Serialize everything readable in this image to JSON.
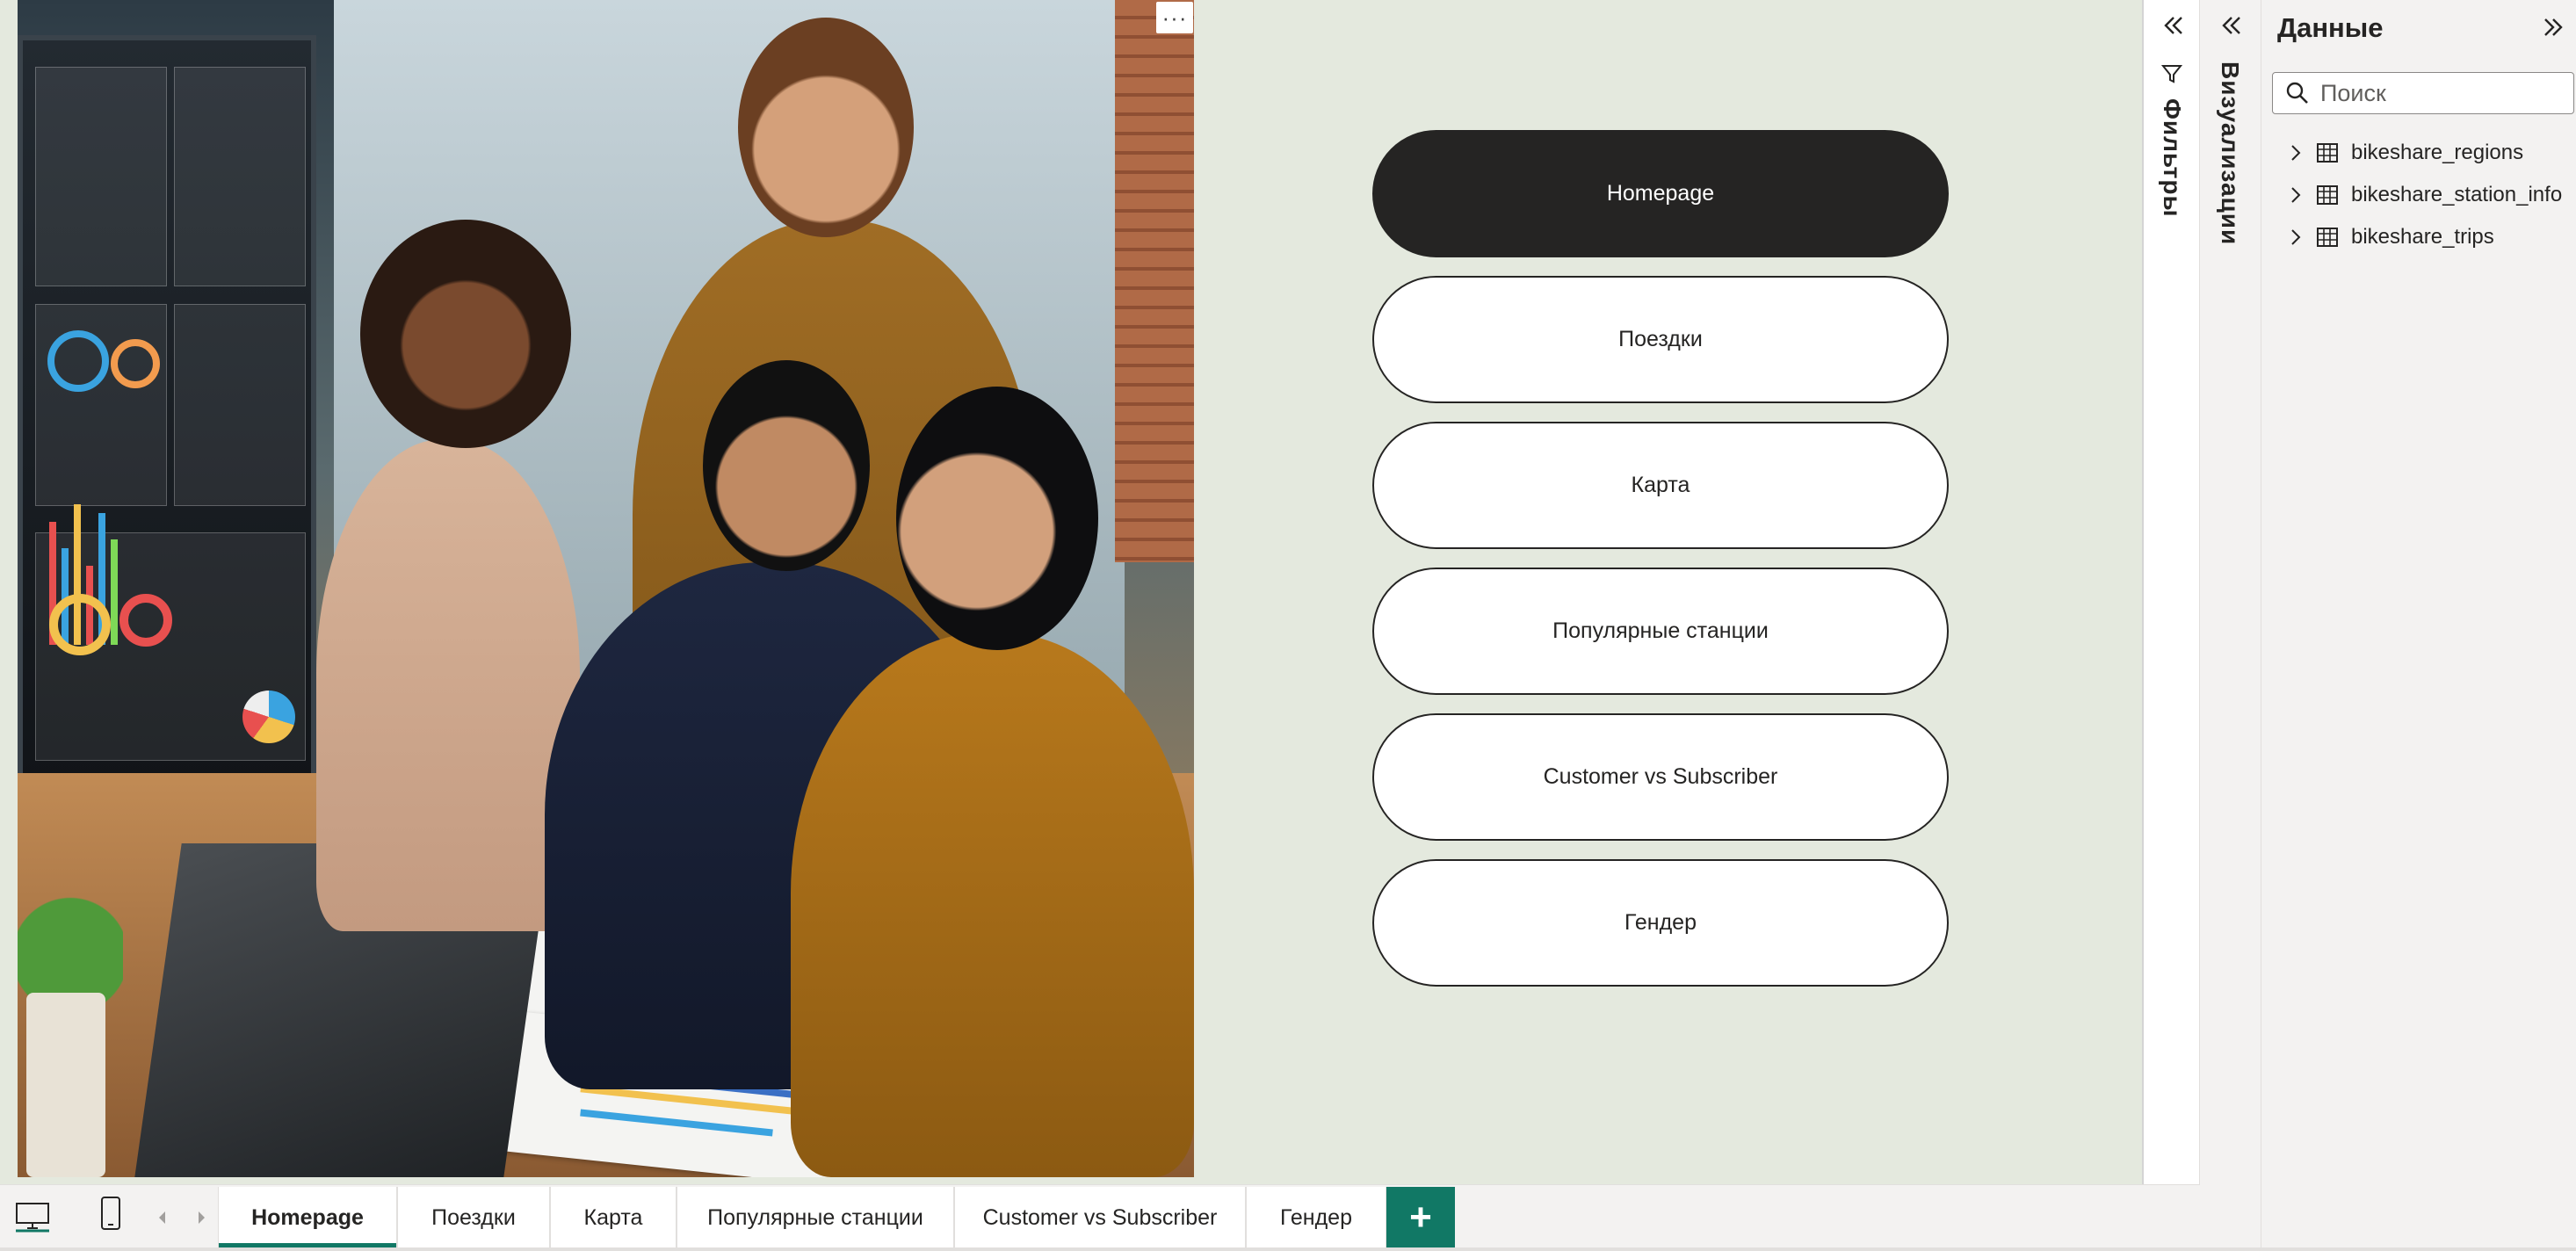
{
  "canvas": {
    "background_color": "#e4e9de",
    "more_options_glyph": "···",
    "nav_buttons": [
      {
        "label": "Homepage",
        "active": true
      },
      {
        "label": "Поездки",
        "active": false
      },
      {
        "label": "Карта",
        "active": false
      },
      {
        "label": "Популярные станции",
        "active": false
      },
      {
        "label": "Customer vs Subscriber",
        "active": false
      },
      {
        "label": "Гендер",
        "active": false
      }
    ]
  },
  "filters_pane": {
    "label": "Фильтры",
    "icons": [
      "collapse-left-icon",
      "filter-icon"
    ]
  },
  "visualizations_pane": {
    "label": "Визуализации",
    "icons": [
      "collapse-left-icon"
    ]
  },
  "data_pane": {
    "title": "Данные",
    "search": {
      "placeholder": "Поиск",
      "value": ""
    },
    "tables": [
      {
        "name": "bikeshare_regions"
      },
      {
        "name": "bikeshare_station_info"
      },
      {
        "name": "bikeshare_trips"
      }
    ],
    "icons": [
      "expand-right-icon",
      "search-icon",
      "chevron-right-icon",
      "table-icon"
    ]
  },
  "page_tabs": {
    "tabs": [
      {
        "label": "Homepage",
        "active": true
      },
      {
        "label": "Поездки",
        "active": false
      },
      {
        "label": "Карта",
        "active": false
      },
      {
        "label": "Популярные станции",
        "active": false
      },
      {
        "label": "Customer vs Subscriber",
        "active": false
      },
      {
        "label": "Гендер",
        "active": false
      }
    ],
    "add_label": "+",
    "icons": [
      "desktop-view-icon",
      "mobile-view-icon",
      "prev-page-icon",
      "next-page-icon"
    ],
    "accent_color": "#117865"
  }
}
